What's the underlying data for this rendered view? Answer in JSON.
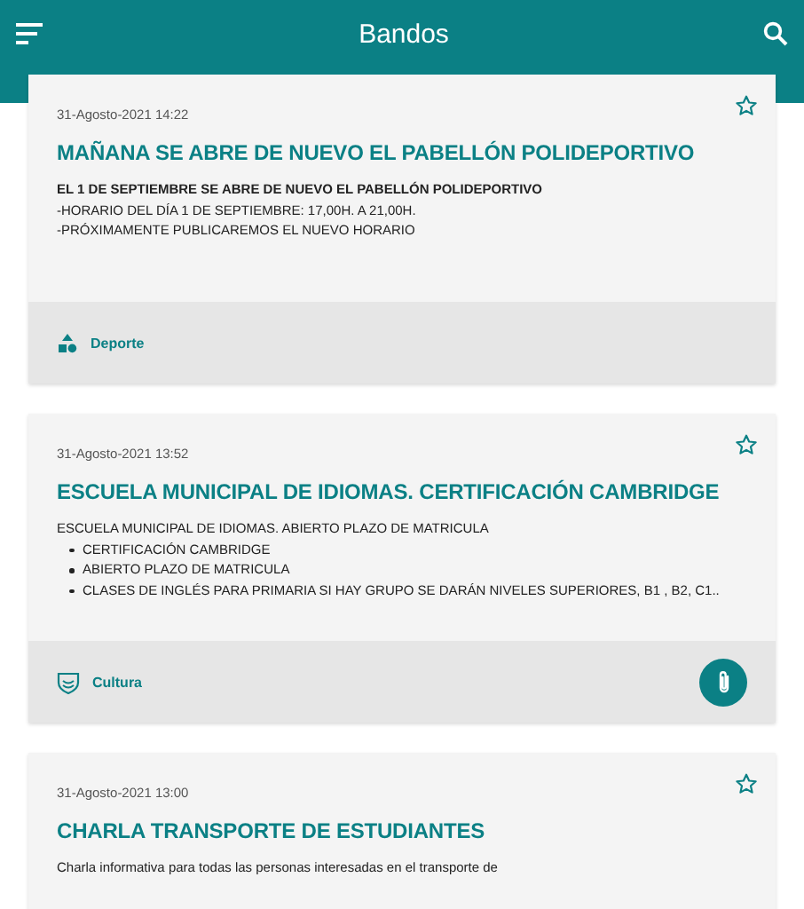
{
  "app_bar": {
    "title": "Bandos"
  },
  "posts": [
    {
      "date": "31-Agosto-2021 14:22",
      "favorite": false,
      "title": "MAÑANA SE ABRE DE NUEVO EL PABELLÓN POLIDEPORTIVO",
      "body": [
        {
          "kind": "bold",
          "text": "EL 1 DE SEPTIEMBRE SE ABRE DE NUEVO EL PABELLÓN POLIDEPORTIVO"
        },
        {
          "kind": "text",
          "text": "-HORARIO DEL DÍA 1 DE SEPTIEMBRE: 17,00H. A 21,00H."
        },
        {
          "kind": "text",
          "text": "-PRÓXIMAMENTE PUBLICAREMOS EL NUEVO HORARIO"
        }
      ],
      "category": {
        "kind": "shapes",
        "label": "Deporte"
      },
      "attachment": false
    },
    {
      "date": "31-Agosto-2021 13:52",
      "favorite": false,
      "title": "ESCUELA MUNICIPAL DE IDIOMAS. CERTIFICACIÓN CAMBRIDGE",
      "body": [
        {
          "kind": "text",
          "text": "ESCUELA MUNICIPAL DE IDIOMAS. ABIERTO PLAZO DE MATRICULA"
        },
        {
          "kind": "bullet",
          "text": "CERTIFICACIÓN CAMBRIDGE"
        },
        {
          "kind": "bullet",
          "text": "ABIERTO PLAZO DE MATRICULA"
        },
        {
          "kind": "bullet",
          "text": "CLASES DE INGLÉS PARA PRIMARIA SI HAY GRUPO SE DARÁN NIVELES SUPERIORES, B1 , B2, C1.."
        }
      ],
      "category": {
        "kind": "shield",
        "label": "Cultura"
      },
      "attachment": true
    },
    {
      "date": "31-Agosto-2021 13:00",
      "favorite": false,
      "title": "CHARLA TRANSPORTE DE ESTUDIANTES",
      "body": [
        {
          "kind": "text",
          "text": "Charla informativa para todas las personas interesadas en el transporte de"
        }
      ]
    }
  ]
}
